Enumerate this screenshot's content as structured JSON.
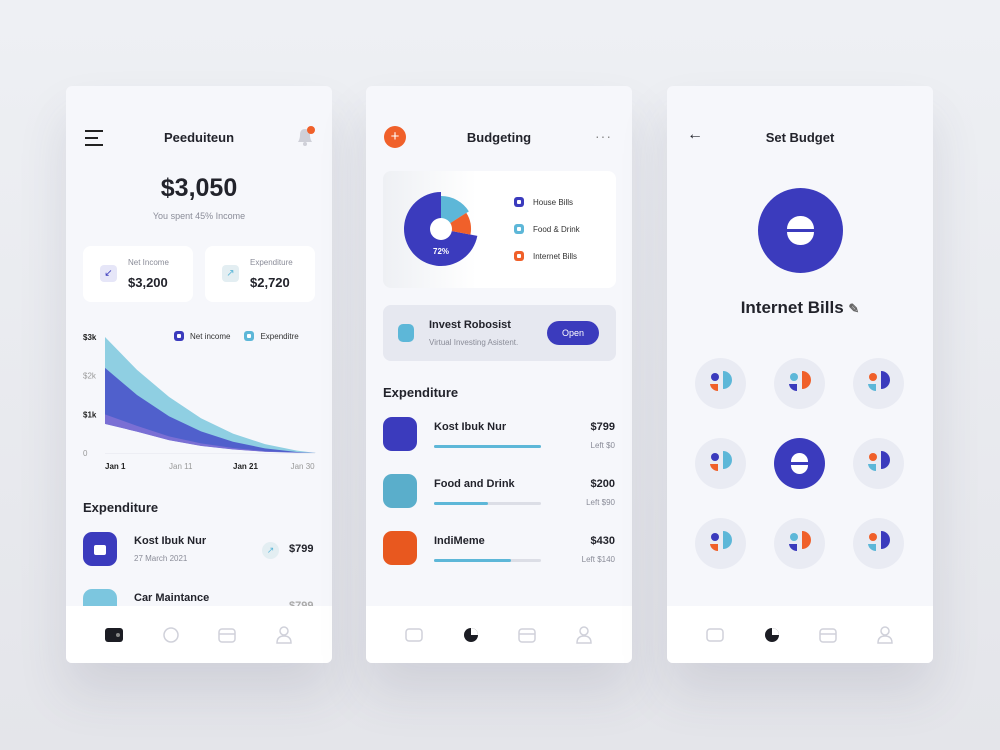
{
  "colors": {
    "primary": "#3b3bbd",
    "light_blue": "#5db7d8",
    "orange": "#f0602a",
    "bg": "#f6f7fb"
  },
  "screen1": {
    "title": "Peeduiteun",
    "balance": "$3,050",
    "subtitle": "You spent 45% Income",
    "net_income": {
      "label": "Net Income",
      "value": "$3,200"
    },
    "expenditure": {
      "label": "Expenditure",
      "value": "$2,720"
    },
    "section": "Expenditure",
    "items": [
      {
        "name": "Kost Ibuk Nur",
        "date": "27 March 2021",
        "amount": "$799"
      },
      {
        "name": "Car Maintance",
        "amount": "$799"
      }
    ],
    "chart_data": {
      "type": "area",
      "yticks": [
        "$3k",
        "$2k",
        "$1k",
        "0"
      ],
      "xticks": [
        "Jan 1",
        "Jan 11",
        "Jan 21",
        "Jan 30"
      ],
      "ylim": [
        0,
        3000
      ],
      "x": [
        1,
        6,
        11,
        16,
        21,
        26,
        31,
        34
      ],
      "series": [
        {
          "name": "Expenditre",
          "color": "#8fcfe2",
          "values": [
            3000,
            2150,
            1450,
            900,
            500,
            230,
            60,
            0
          ]
        },
        {
          "name": "Net income",
          "color": "#5060cc",
          "values": [
            2200,
            1500,
            950,
            560,
            290,
            120,
            25,
            0
          ]
        },
        {
          "color": "#7a6fd4",
          "values": [
            1000,
            700,
            430,
            250,
            130,
            50,
            10,
            0
          ]
        },
        {
          "color": "#f6f7fb",
          "values": [
            750,
            550,
            330,
            180,
            90,
            30,
            5,
            0
          ]
        }
      ],
      "legend": "top-right"
    }
  },
  "screen2": {
    "title": "Budgeting",
    "pie": {
      "center_label": "72%",
      "slices": [
        {
          "label": "House Bills",
          "value": 72,
          "color": "#3b3bbd"
        },
        {
          "label": "Food & Drink",
          "value": 16,
          "color": "#5db7d8"
        },
        {
          "label": "Internet Bills",
          "value": 12,
          "color": "#f0602a"
        }
      ]
    },
    "promo": {
      "title": "Invest Robosist",
      "subtitle": "Virtual Investing Asistent.",
      "button": "Open"
    },
    "section": "Expenditure",
    "items": [
      {
        "name": "Kost Ibuk Nur",
        "amount": "$799",
        "left": "Left $0",
        "progress": 100,
        "color": "#3b3bbd"
      },
      {
        "name": "Food and Drink",
        "amount": "$200",
        "left": "Left $90",
        "progress": 50,
        "color": "#5aaecb"
      },
      {
        "name": "IndiMeme",
        "amount": "$430",
        "left": "Left $140",
        "progress": 72,
        "color": "#e8581f"
      }
    ]
  },
  "screen3": {
    "title": "Set Budget",
    "category": "Internet Bills",
    "selected_icon": 4
  }
}
